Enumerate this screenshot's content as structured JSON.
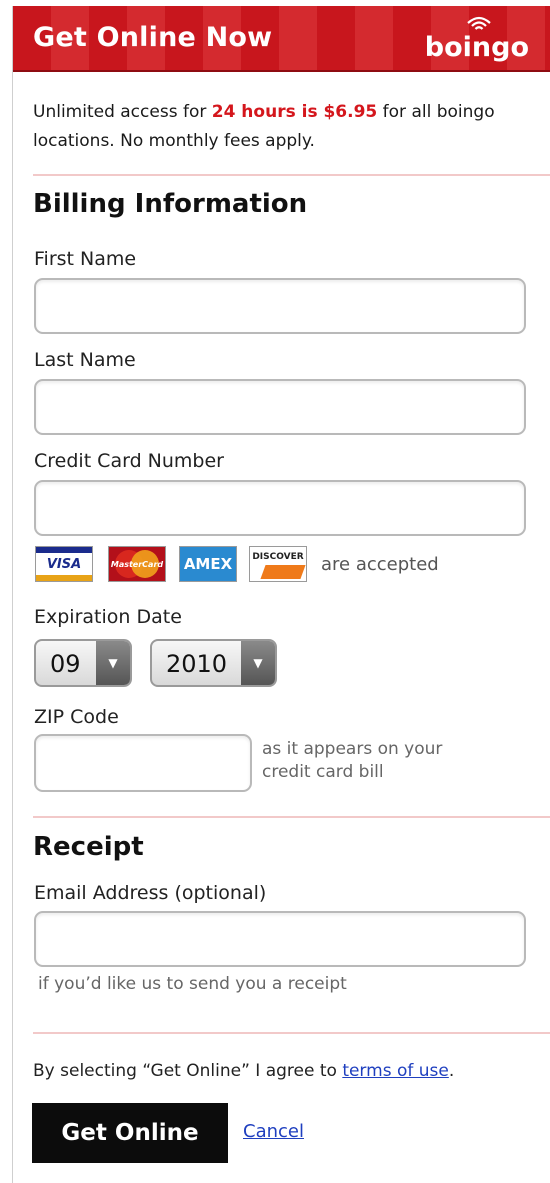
{
  "header": {
    "title": "Get Online Now",
    "brand": "boingo",
    "brand_icon": "wifi-signal-icon"
  },
  "intro": {
    "before": "Unlimited access for ",
    "highlight": "24 hours is $6.95",
    "after": " for all boingo locations. No monthly fees apply."
  },
  "billing": {
    "heading": "Billing Information",
    "first_name_label": "First Name",
    "first_name_value": "",
    "last_name_label": "Last Name",
    "last_name_value": "",
    "card_number_label": "Credit Card Number",
    "card_number_value": "",
    "cards": [
      {
        "name": "VISA",
        "icon": "visa-card-icon"
      },
      {
        "name": "MasterCard",
        "icon": "mastercard-icon"
      },
      {
        "name": "AMEX",
        "icon": "amex-card-icon"
      },
      {
        "name": "DISCOVER",
        "icon": "discover-card-icon"
      }
    ],
    "cards_note": "are accepted",
    "expiration_label": "Expiration Date",
    "expiration_month": "09",
    "expiration_year": "2010",
    "zip_label": "ZIP Code",
    "zip_value": "",
    "zip_hint_line1": "as it appears on your",
    "zip_hint_line2": "credit card bill"
  },
  "receipt": {
    "heading": "Receipt",
    "email_label": "Email Address (optional)",
    "email_value": "",
    "email_hint": "if you’d like us to send you a receipt"
  },
  "footer": {
    "agree_text": "By selecting “Get Online” I agree to ",
    "terms_link": "terms of use",
    "agree_end": ".",
    "submit_label": "Get Online",
    "cancel_label": "Cancel"
  },
  "colors": {
    "header_red": "#c8161d",
    "highlight_red": "#d4161c",
    "link_blue": "#1f3fbf",
    "divider_pink": "#f2c9c9"
  }
}
